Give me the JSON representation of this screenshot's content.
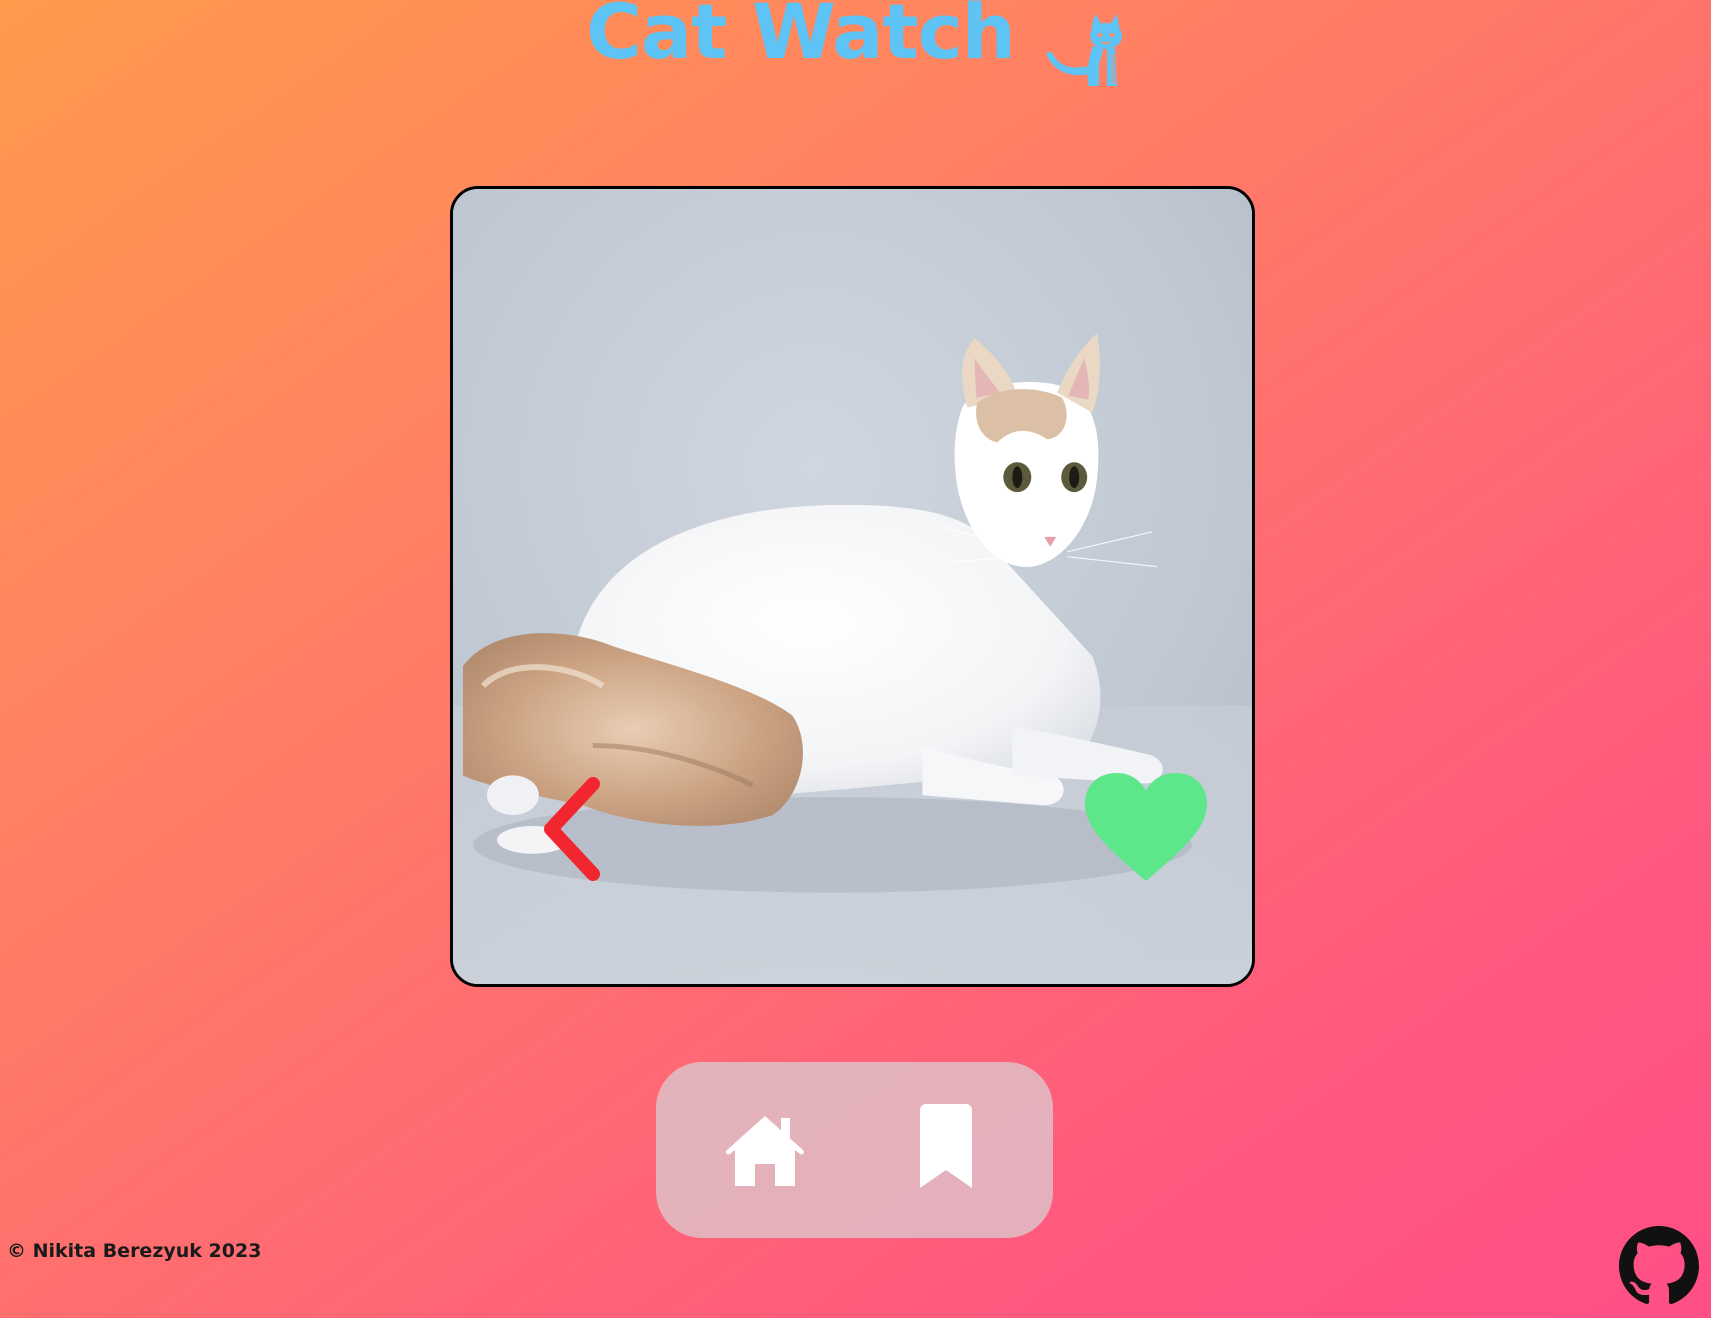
{
  "app": {
    "title": "Cat Watch",
    "title_icon": "cat-icon"
  },
  "card": {
    "image_description": "white and cream long-tailed cat lying on grey backdrop",
    "back_icon": "chevron-left-icon",
    "like_icon": "heart-icon"
  },
  "nav": {
    "items": [
      {
        "icon": "home-icon"
      },
      {
        "icon": "bookmark-icon"
      }
    ]
  },
  "footer": {
    "copyright": "© Nikita Berezyuk 2023",
    "github_icon": "github-icon"
  },
  "colors": {
    "title": "#5ec3f5",
    "back": "#f2262e",
    "like": "#5ee68a",
    "nav_bg": "#e1b9bd",
    "nav_icon": "#ffffff"
  }
}
